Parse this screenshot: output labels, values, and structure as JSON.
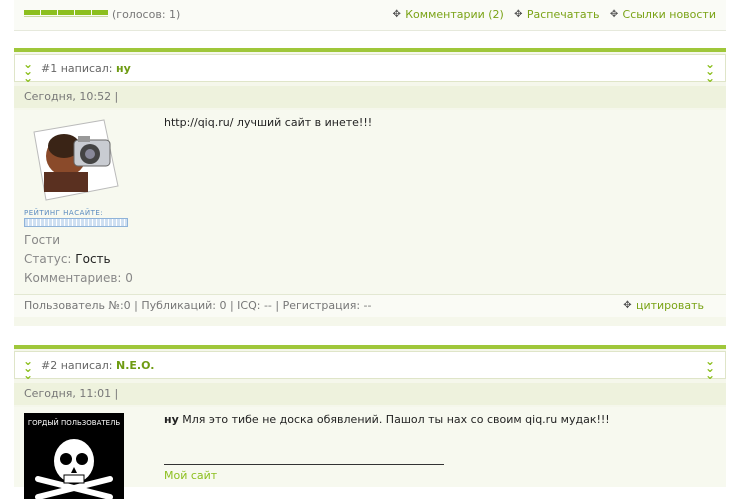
{
  "rating": {
    "votes": "(голосов: 1)",
    "links": [
      {
        "label": "Комментарии (2)"
      },
      {
        "label": "Распечатать"
      },
      {
        "label": "Ссылки новости"
      }
    ]
  },
  "comments": [
    {
      "number": "#1",
      "wrote": "написал:",
      "author": "ну",
      "date": "Сегодня, 10:52 |",
      "text": "http://qiq.ru/ лучший сайт в инете!!!",
      "rating_label": "РЕЙТИНГ НАСАЙТЕ:",
      "group": "Гости",
      "status_label": "Статус:",
      "status_value": "Гость",
      "comments_count": "Комментариев: 0",
      "footer": "Пользователь №:0 | Публикаций: 0 | ICQ: -- | Регистрация: --",
      "quote": "цитировать"
    },
    {
      "number": "#2",
      "wrote": "написал:",
      "author": "N.E.O.",
      "date": "Сегодня, 11:01 |",
      "quoted_author": "ну",
      "text": "Мля это тибе не доска обявлений. Пашол ты нах со своим qiq.ru мудак!!!",
      "avatar_caption": "ГОРДЫЙ ПОЛЬЗОВАТЕЛЬ",
      "signature": "Мой сайт"
    }
  ]
}
